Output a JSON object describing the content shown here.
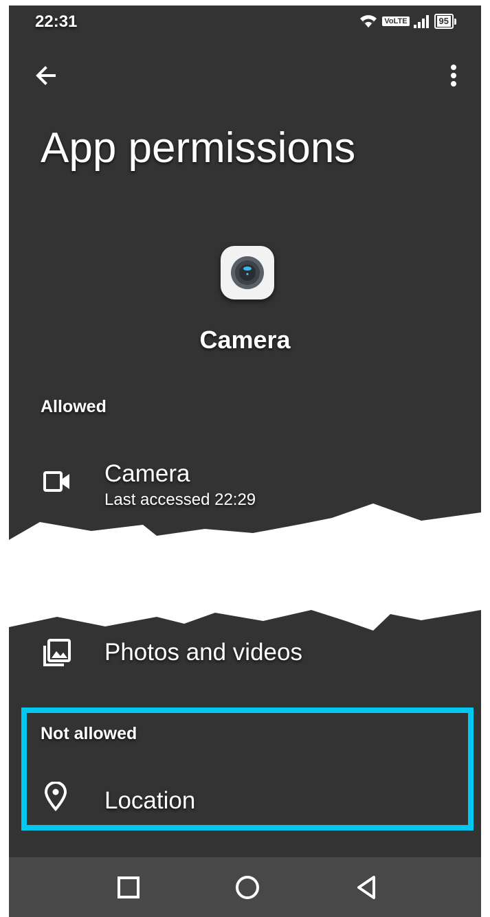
{
  "status_bar": {
    "time": "22:31",
    "network_label": "VoLTE",
    "battery": "95",
    "icons": [
      "wifi-icon",
      "signal-icon",
      "battery-icon"
    ]
  },
  "header": {
    "title": "App permissions",
    "back_icon": "arrow-left-icon",
    "menu_icon": "more-vert-icon"
  },
  "app": {
    "name": "Camera",
    "icon": "camera-app-icon"
  },
  "sections": {
    "allowed": {
      "label": "Allowed",
      "items": [
        {
          "title": "Camera",
          "subtitle": "Last accessed 22:29",
          "icon": "video-camera-icon"
        },
        {
          "title": "Photos and videos",
          "icon": "photo-library-icon"
        }
      ]
    },
    "not_allowed": {
      "label": "Not allowed",
      "items": [
        {
          "title": "Location",
          "icon": "location-pin-icon"
        }
      ]
    }
  },
  "nav_bar": {
    "buttons": [
      "recents-square-icon",
      "home-circle-icon",
      "back-triangle-icon"
    ]
  },
  "colors": {
    "background": "#333333",
    "text": "#ffffff",
    "highlight": "#00c8f0",
    "nav_bar": "#484848"
  }
}
